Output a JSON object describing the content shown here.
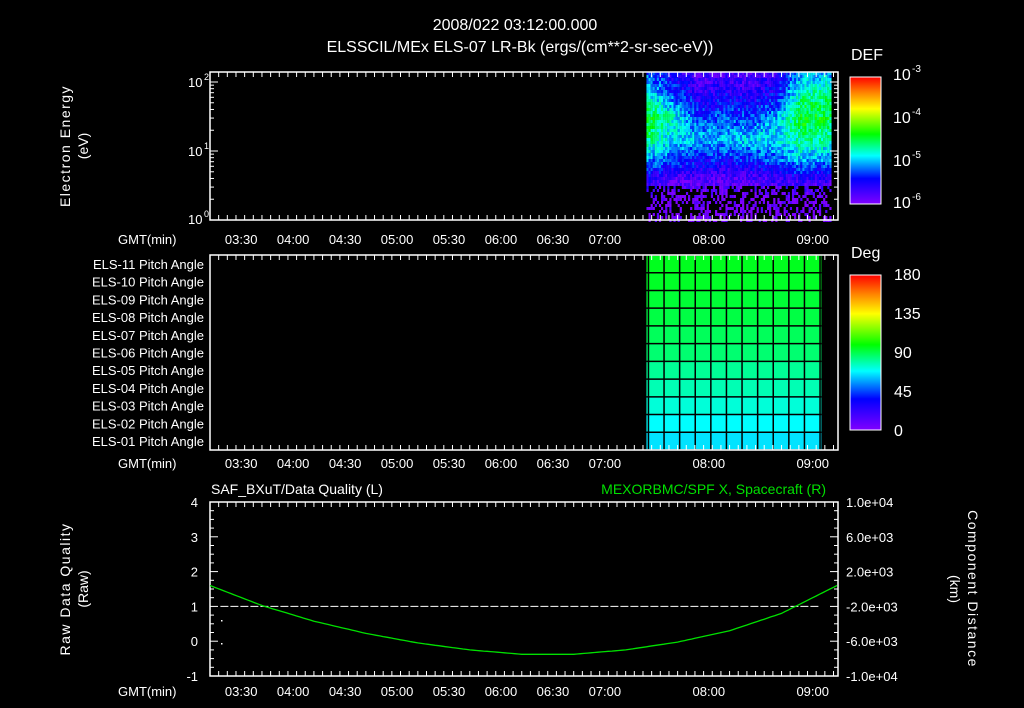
{
  "header": {
    "datetime": "2008/022 03:12:00.000",
    "title": "ELSSCIL/MEx ELS-07 LR-Bk  (ergs/(cm**2-sr-sec-eV))"
  },
  "colors": {
    "background": "#000000",
    "axis": "#ffffff",
    "curve": "#00e000",
    "right_title": "#00e000"
  },
  "time_axis": {
    "label": "GMT(min)",
    "start_min_after_0312": 0,
    "end_min_after_0312": 362,
    "ticks": [
      {
        "label": "03:30",
        "min": 18
      },
      {
        "label": "04:00",
        "min": 48
      },
      {
        "label": "04:30",
        "min": 78
      },
      {
        "label": "05:00",
        "min": 108
      },
      {
        "label": "05:30",
        "min": 138
      },
      {
        "label": "06:00",
        "min": 168
      },
      {
        "label": "06:30",
        "min": 198
      },
      {
        "label": "07:00",
        "min": 228
      },
      {
        "label": "08:00",
        "min": 288
      },
      {
        "label": "09:00",
        "min": 348
      }
    ]
  },
  "chart_data": [
    {
      "type": "heatmap",
      "title": "ELSSCIL/MEx ELS-07 LR-Bk  (ergs/(cm**2-sr-sec-eV))",
      "ylabel": "Electron Energy",
      "yunits": "(eV)",
      "yscale": "log",
      "ylim": [
        1,
        140
      ],
      "yticks": [
        {
          "label": "10",
          "exp": "0",
          "value": 1
        },
        {
          "label": "10",
          "exp": "1",
          "value": 10
        },
        {
          "label": "10",
          "exp": "2",
          "value": 100
        }
      ],
      "data_time_start_min": 252,
      "data_time_end_min": 358,
      "energies_eV": [
        2,
        4,
        8,
        16,
        32,
        64,
        128
      ],
      "times_min": [
        252,
        267,
        282,
        297,
        312,
        327,
        342,
        357
      ],
      "log10_def": [
        [
          -6.0,
          -6.0,
          -6.0,
          -6.0,
          -6.0,
          -6.0,
          -6.0,
          -6.0
        ],
        [
          -5.6,
          -5.8,
          -5.8,
          -5.8,
          -5.8,
          -5.7,
          -5.6,
          -5.7
        ],
        [
          -5.1,
          -5.2,
          -5.4,
          -5.4,
          -5.3,
          -5.2,
          -5.0,
          -5.1
        ],
        [
          -4.6,
          -4.9,
          -5.0,
          -5.0,
          -4.9,
          -4.9,
          -4.6,
          -4.7
        ],
        [
          -4.4,
          -4.8,
          -5.3,
          -5.2,
          -5.3,
          -5.0,
          -4.4,
          -4.5
        ],
        [
          -4.8,
          -5.2,
          -5.6,
          -5.5,
          -5.6,
          -5.4,
          -4.6,
          -4.6
        ],
        [
          -5.2,
          -5.5,
          -5.8,
          -5.7,
          -5.8,
          -5.6,
          -5.0,
          -5.0
        ]
      ],
      "colorbar": {
        "title": "DEF",
        "range_log10": [
          -6,
          -3
        ],
        "ticks": [
          {
            "base": "10",
            "exp": "-3"
          },
          {
            "base": "10",
            "exp": "-4"
          },
          {
            "base": "10",
            "exp": "-5"
          },
          {
            "base": "10",
            "exp": "-6"
          }
        ]
      }
    },
    {
      "type": "heatmap",
      "title": "Pitch Angle",
      "rows": [
        "ELS-11 Pitch Angle",
        "ELS-10 Pitch Angle",
        "ELS-09 Pitch Angle",
        "ELS-08 Pitch Angle",
        "ELS-07 Pitch Angle",
        "ELS-06 Pitch Angle",
        "ELS-05 Pitch Angle",
        "ELS-04 Pitch Angle",
        "ELS-03 Pitch Angle",
        "ELS-02 Pitch Angle",
        "ELS-01 Pitch Angle"
      ],
      "values_deg": [
        104,
        103,
        101,
        99,
        96,
        93,
        88,
        84,
        79,
        74,
        70
      ],
      "data_time_start_min": 252,
      "data_time_end_min": 353,
      "colorbar": {
        "title": "Deg",
        "range": [
          0,
          180
        ],
        "ticks": [
          "180",
          "135",
          "90",
          "45",
          "0"
        ]
      }
    },
    {
      "type": "line",
      "left_title": "SAF_BXuT/Data Quality (L)",
      "right_title": "MEXORBMC/SPF X, Spacecraft (R)",
      "ylabel": "Raw Data Quality",
      "yunits": "(Raw)",
      "ylim": [
        -1,
        4
      ],
      "yticks": [
        "4",
        "3",
        "2",
        "1",
        "0",
        "-1"
      ],
      "y2label": "Component Distance",
      "y2units": "(km)",
      "y2lim": [
        -10000,
        10000
      ],
      "y2ticks": [
        "1.0e+04",
        "6.0e+03",
        "2.0e+03",
        "-2.0e+03",
        "-6.0e+03",
        "-1.0e+04"
      ],
      "series": [
        {
          "name": "Data Quality",
          "style": "dashed",
          "x_min": [
            6,
            352
          ],
          "y": [
            1,
            1
          ]
        },
        {
          "name": "SPF X",
          "axis": "right",
          "x_min": [
            0,
            30,
            60,
            90,
            120,
            150,
            180,
            210,
            240,
            270,
            300,
            330,
            362
          ],
          "y_km": [
            400,
            -1900,
            -3700,
            -5100,
            -6200,
            -7000,
            -7500,
            -7500,
            -7000,
            -6100,
            -4800,
            -2800,
            400
          ]
        }
      ]
    }
  ]
}
